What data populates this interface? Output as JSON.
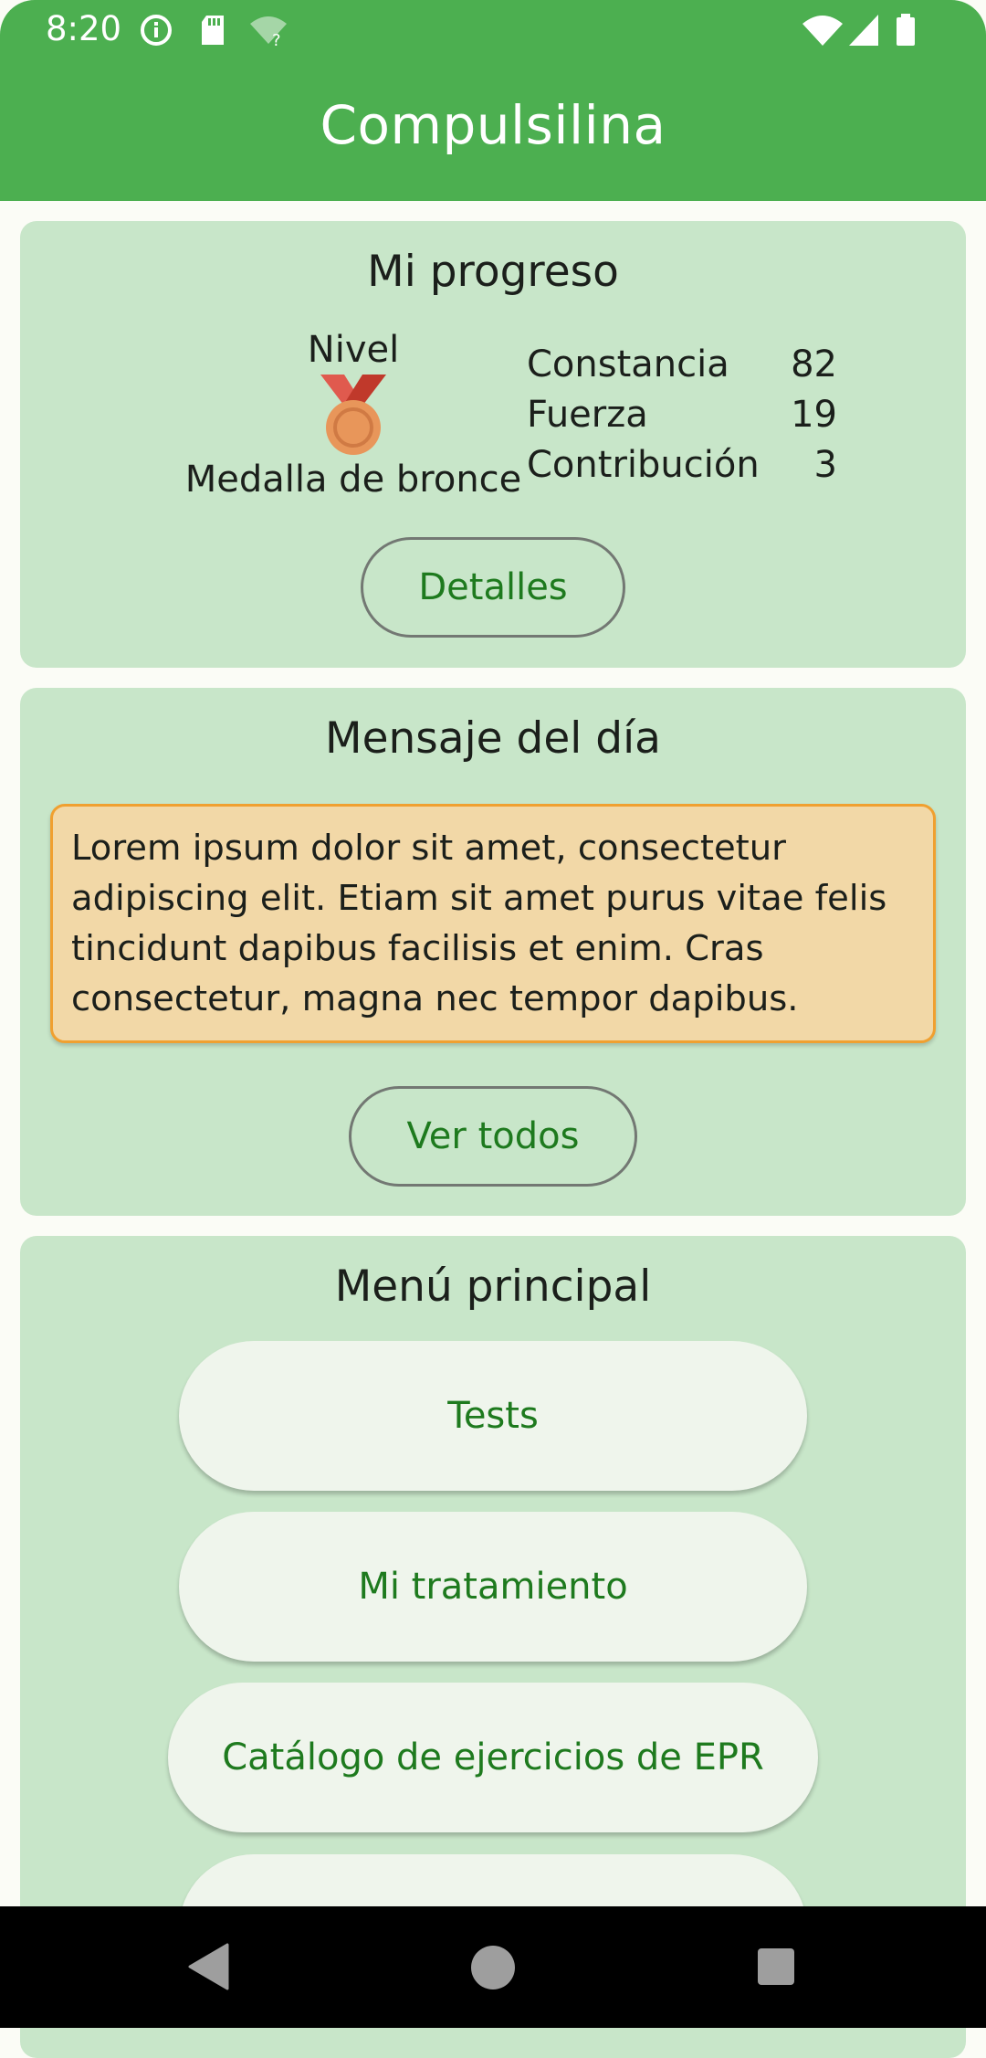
{
  "status_bar": {
    "time": "8:20",
    "icons": [
      "info-icon",
      "sd-card-icon",
      "wifi-unknown-icon",
      "wifi-icon",
      "signal-icon",
      "battery-icon"
    ]
  },
  "app_bar": {
    "title": "Compulsilina",
    "color": "#4CAF50"
  },
  "progress": {
    "title": "Mi progreso",
    "level_label": "Nivel",
    "medal_icon": "bronze-medal-icon",
    "medal_label": "Medalla de bronce",
    "stats": [
      {
        "label": "Constancia",
        "value": "82"
      },
      {
        "label": "Fuerza",
        "value": "19"
      },
      {
        "label": "Contribución",
        "value": "3"
      }
    ],
    "details_button": "Detalles"
  },
  "message": {
    "title": "Mensaje del día",
    "text": "Lorem ipsum dolor sit amet, consectetur adipiscing elit. Etiam sit amet purus vitae felis tincidunt dapibus facilisis et enim. Cras consectetur, magna nec tempor dapibus.",
    "all_button": "Ver todos"
  },
  "menu": {
    "title": "Menú principal",
    "items": [
      {
        "label": "Tests"
      },
      {
        "label": "Mi tratamiento"
      },
      {
        "label": "Catálogo de ejercicios de EPR"
      },
      {
        "label": ""
      }
    ]
  },
  "nav": {
    "icons": [
      "back-icon",
      "home-icon",
      "recents-icon"
    ]
  },
  "colors": {
    "primary": "#4CAF50",
    "card": "#C8E6C9",
    "accent_text": "#1E7A1E",
    "message_bg": "#F2D8A7",
    "message_border": "#F0A030"
  }
}
